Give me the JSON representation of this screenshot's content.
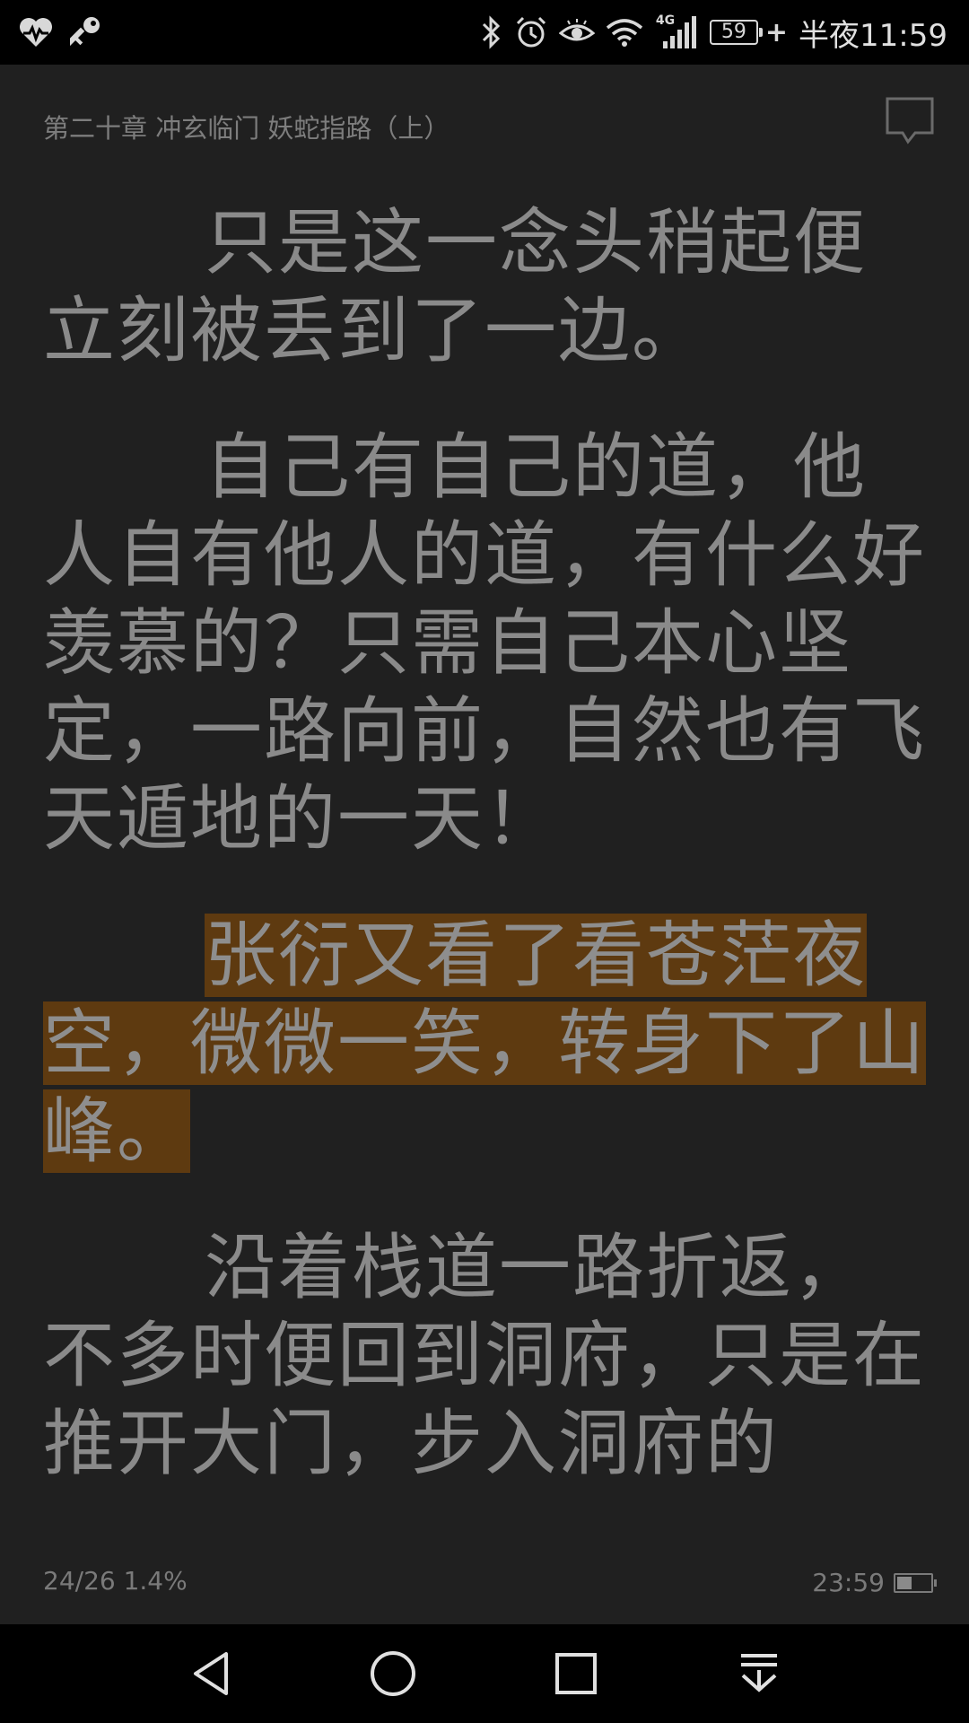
{
  "status_bar": {
    "network_label": "4G",
    "battery_level": "59",
    "charging_symbol": "+",
    "time": "半夜11:59",
    "icons": [
      "health-icon",
      "key-icon",
      "bluetooth-icon",
      "alarm-icon",
      "eye-icon",
      "wifi-icon",
      "signal-icon",
      "battery-icon"
    ]
  },
  "reader": {
    "chapter_title": "第二十章 冲玄临门 妖蛇指路（上）",
    "paragraphs": [
      "只是这一念头稍起便立刻被丢到了一边。",
      "自己有自己的道，他人自有他人的道，有什么好羡慕的？只需自己本心坚定，一路向前，自然也有飞天遁地的一天！",
      "张衍又看了看苍茫夜空，微微一笑，转身下了山峰。",
      "沿着栈道一路折返，不多时便回到洞府，只是在推开大门，步入洞府的"
    ],
    "highlighted_paragraph_index": 2,
    "highlight_color": "#5e3a10",
    "background_color": "#202020",
    "text_color": "#8a8a8a",
    "footer": {
      "page_progress": "24/26  1.4%",
      "clock": "23:59",
      "battery_fraction": 0.45
    }
  },
  "nav_bar": {
    "buttons": [
      "back-icon",
      "home-icon",
      "recents-icon",
      "pull-down-icon"
    ]
  }
}
